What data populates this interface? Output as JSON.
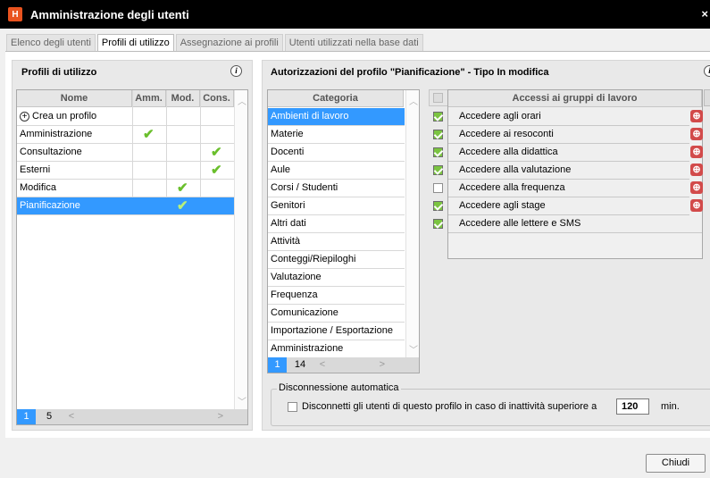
{
  "window": {
    "title": "Amministrazione degli utenti",
    "app_icon": "H",
    "close": "×"
  },
  "tabs": [
    "Elenco degli utenti",
    "Profili di utilizzo",
    "Assegnazione ai profili",
    "Utenti utilizzati nella base dati"
  ],
  "left": {
    "title": "Profili di utilizzo",
    "columns": [
      "Nome",
      "Amm.",
      "Mod.",
      "Cons."
    ],
    "create": "Crea un profilo",
    "rows": [
      "Amministrazione",
      "Consultazione",
      "Esterni",
      "Modifica",
      "Pianificazione"
    ],
    "footer": {
      "page": "1",
      "count": "5"
    }
  },
  "right": {
    "title": "Autorizzazioni del profilo \"Pianificazione\" - Tipo In modifica",
    "cat_header": "Categoria",
    "categories": [
      "Ambienti di lavoro",
      "Materie",
      "Docenti",
      "Aule",
      "Corsi / Studenti",
      "Genitori",
      "Altri dati",
      "Attività",
      "Conteggi/Riepiloghi",
      "Valutazione",
      "Frequenza",
      "Comunicazione",
      "Importazione / Esportazione",
      "Amministrazione"
    ],
    "cat_footer": {
      "page": "1",
      "count": "14"
    },
    "acc_header": "Accessi ai gruppi di lavoro",
    "access": [
      "Accedere agli orari",
      "Accedere ai resoconti",
      "Accedere alla didattica",
      "Accedere alla valutazione",
      "Accedere alla frequenza",
      "Accedere agli stage",
      "Accedere alle lettere e SMS"
    ],
    "access_checked": [
      true,
      true,
      true,
      true,
      false,
      true,
      true
    ],
    "fieldset": "Disconnessione automatica",
    "disconnect_label": "Disconnetti gli utenti di questo profilo in caso di inattività superiore a",
    "minutes": "120",
    "min_label": "min."
  },
  "buttons": {
    "close": "Chiudi"
  },
  "colors": {
    "selection": "#3399ff",
    "check": "#6abf2c",
    "titlebar": "#000000",
    "pin": "#d24a4a"
  }
}
